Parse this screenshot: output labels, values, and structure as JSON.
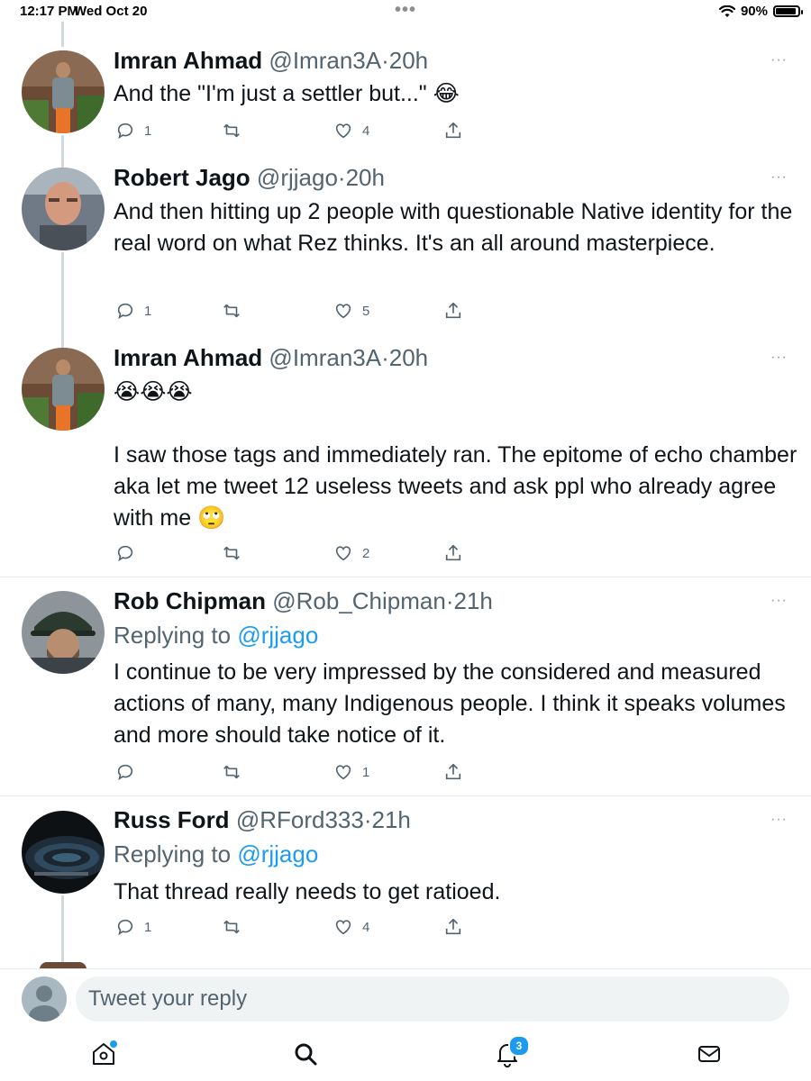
{
  "status_bar": {
    "time": "12:17 PM",
    "date": "Wed Oct 20",
    "battery": "90%"
  },
  "tweets": [
    {
      "name": "Imran Ahmad",
      "handle": "@Imran3A",
      "time": "20h",
      "text": "And the \"I'm just a settler but...\" 😂",
      "replies": "1",
      "retweets": "",
      "likes": "4",
      "more": "···"
    },
    {
      "name": "Robert Jago",
      "handle": "@rjjago",
      "time": "20h",
      "text": "And then hitting up 2 people with questionable Native identity for the real word on what Rez thinks. It's an all around masterpiece.",
      "replies": "1",
      "retweets": "",
      "likes": "5",
      "more": "···"
    },
    {
      "name": "Imran Ahmad",
      "handle": "@Imran3A",
      "time": "20h",
      "text_line1": "😭😭😭",
      "text": "I saw those tags and immediately ran. The epitome of echo chamber aka let me tweet 12 useless tweets and ask ppl who already agree with me 🙄",
      "replies": "",
      "retweets": "",
      "likes": "2",
      "more": "···"
    },
    {
      "name": "Rob Chipman",
      "handle": "@Rob_Chipman",
      "time": "21h",
      "replying_prefix": "Replying to",
      "replying_to": "@rjjago",
      "text": "I continue to be very impressed by the considered and measured actions of many, many Indigenous people. I think it speaks volumes and more should take notice of it.",
      "replies": "",
      "retweets": "",
      "likes": "1",
      "more": "···"
    },
    {
      "name": "Russ Ford",
      "handle": "@RFord333",
      "time": "21h",
      "replying_prefix": "Replying to",
      "replying_to": "@rjjago",
      "text": "That thread really needs to get ratioed.",
      "replies": "1",
      "retweets": "",
      "likes": "4",
      "more": "···"
    }
  ],
  "reply_bar": {
    "placeholder": "Tweet your reply"
  },
  "tab_bar": {
    "items": [
      {
        "icon": "home-icon"
      },
      {
        "icon": "search-icon"
      },
      {
        "icon": "notifications-icon",
        "badge": "3"
      },
      {
        "icon": "messages-icon"
      }
    ]
  },
  "colors": {
    "accent": "#1d9bf0",
    "secondary_text": "#536471",
    "text": "#0f1419"
  }
}
